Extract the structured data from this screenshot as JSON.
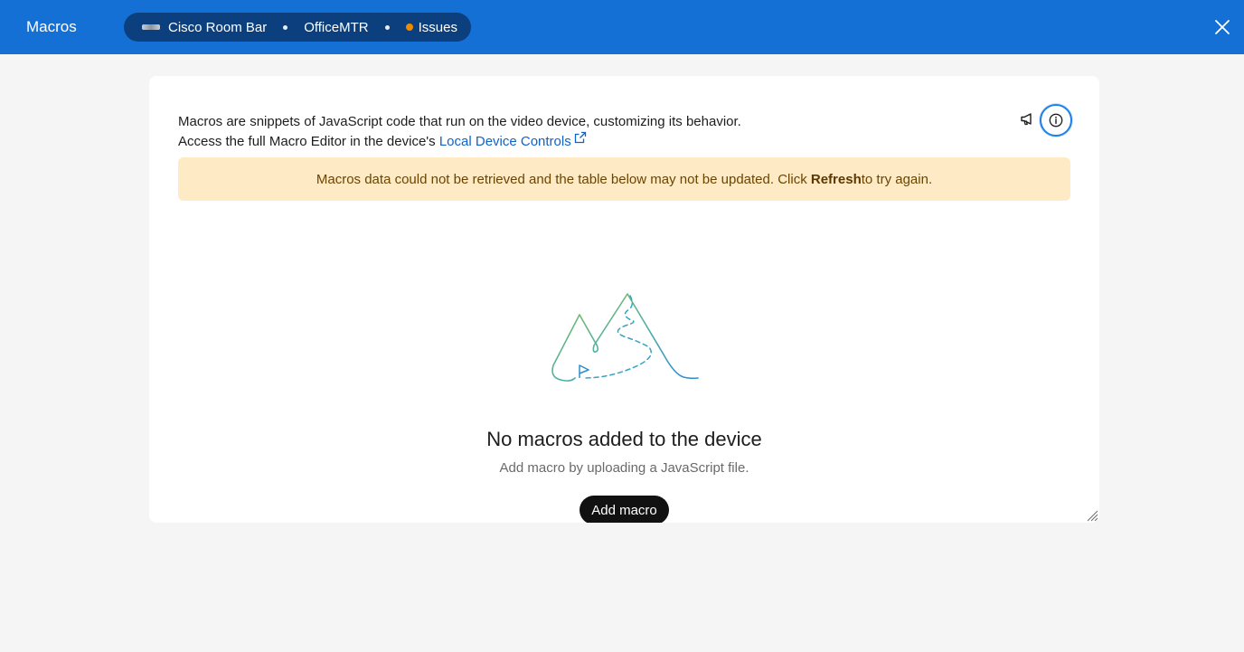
{
  "header": {
    "title": "Macros",
    "device_name": "Cisco Room Bar",
    "location": "OfficeMTR",
    "status": "Issues",
    "status_color": "#f08a00",
    "close_icon": "close-icon"
  },
  "intro": {
    "line1": "Macros are snippets of JavaScript code that run on the video device, customizing its behavior.",
    "line2_prefix": "Access the full Macro Editor in the device's ",
    "link_label": "Local Device Controls"
  },
  "warning": {
    "prefix": "Macros data could not be retrieved and the table below may not be updated. Click ",
    "action": "Refresh",
    "suffix": " to try again."
  },
  "empty_state": {
    "title": "No macros added to the device",
    "subtitle": "Add macro by uploading a JavaScript file.",
    "button_label": "Add macro"
  },
  "colors": {
    "header_bg": "#1570d6",
    "pill_bg": "#0c3f7d",
    "warning_bg": "#feebc5",
    "link": "#0f63c6",
    "primary_button": "#111111"
  }
}
